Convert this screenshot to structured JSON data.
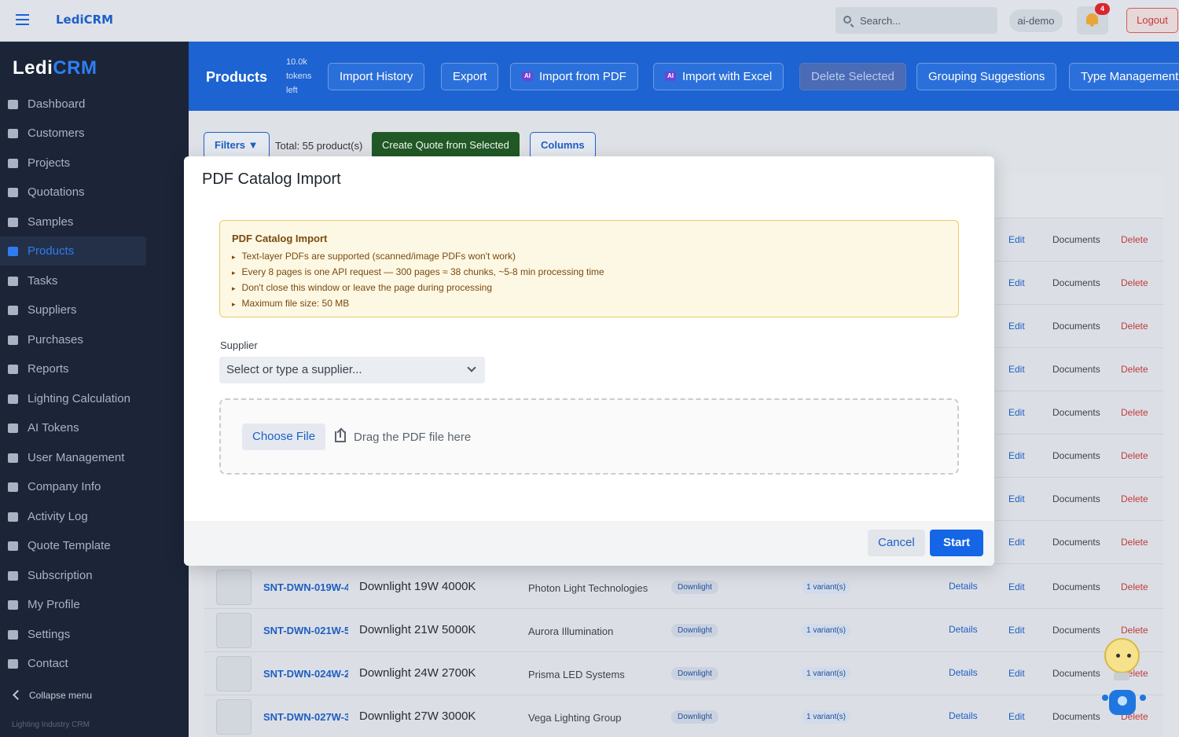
{
  "app": {
    "brand": "LediCRM",
    "logo_part1": "Ledi",
    "logo_part2": "CRM",
    "footer_note": "Lighting Industry CRM"
  },
  "topbar": {
    "search_placeholder": "Search...",
    "user": "ai-demo",
    "notification_count": "4",
    "logout_label": "Logout"
  },
  "sidebar": {
    "items": [
      {
        "label": "Dashboard",
        "icon": "dashboard-icon"
      },
      {
        "label": "Customers",
        "icon": "users-icon"
      },
      {
        "label": "Projects",
        "icon": "folder-icon"
      },
      {
        "label": "Quotations",
        "icon": "document-icon"
      },
      {
        "label": "Samples",
        "icon": "cube-icon"
      },
      {
        "label": "Products",
        "icon": "lightbulb-icon",
        "active": true
      },
      {
        "label": "Tasks",
        "icon": "list-icon"
      },
      {
        "label": "Suppliers",
        "icon": "truck-icon"
      },
      {
        "label": "Purchases",
        "icon": "cart-icon"
      },
      {
        "label": "Reports",
        "icon": "chart-icon"
      },
      {
        "label": "Lighting Calculation",
        "icon": "gear-icon"
      },
      {
        "label": "AI Tokens",
        "icon": "coins-icon"
      },
      {
        "label": "User Management",
        "icon": "user-icon"
      },
      {
        "label": "Company Info",
        "icon": "building-icon"
      },
      {
        "label": "Activity Log",
        "icon": "history-icon"
      },
      {
        "label": "Quote Template",
        "icon": "wand-icon"
      },
      {
        "label": "Subscription",
        "icon": "card-icon"
      },
      {
        "label": "My Profile",
        "icon": "profile-icon"
      },
      {
        "label": "Settings",
        "icon": "settings-icon"
      },
      {
        "label": "Contact",
        "icon": "mail-icon"
      }
    ],
    "collapse_label": "Collapse menu"
  },
  "products_header": {
    "title": "Products",
    "tokens": "10.0k tokens left",
    "buttons": {
      "import_history": "Import History",
      "export": "Export",
      "ai_tag": "AI",
      "import_pdf": "Import from PDF",
      "import_excel": "Import with Excel",
      "delete_selected": "Delete Selected",
      "grouping": "Grouping Suggestions",
      "type_management": "Type Management"
    }
  },
  "toolbar": {
    "filters": "Filters ▼",
    "total": "Total: 55 product(s)",
    "create_quote": "Create Quote from Selected",
    "columns": "Columns"
  },
  "table": {
    "action_labels": {
      "details": "Details",
      "edit": "Edit",
      "documents": "Documents",
      "delete": "Delete"
    },
    "rows": [
      {
        "code": "SNT-DWN-019W-4",
        "name": "Downlight 19W 4000K",
        "supplier": "Photon Light Technologies",
        "category": "Downlight",
        "variants": "1 variant(s)"
      },
      {
        "code": "SNT-DWN-021W-5",
        "name": "Downlight 21W 5000K",
        "supplier": "Aurora Illumination",
        "category": "Downlight",
        "variants": "1 variant(s)"
      },
      {
        "code": "SNT-DWN-024W-2",
        "name": "Downlight 24W 2700K",
        "supplier": "Prisma LED Systems",
        "category": "Downlight",
        "variants": "1 variant(s)"
      },
      {
        "code": "SNT-DWN-027W-3",
        "name": "Downlight 27W 3000K",
        "supplier": "Vega Lighting Group",
        "category": "Downlight",
        "variants": "1 variant(s)"
      }
    ]
  },
  "modal": {
    "title": "PDF Catalog Import",
    "alert_title": "PDF Catalog Import",
    "alert_items": [
      "Text-layer PDFs are supported (scanned/image PDFs won't work)",
      "Every 8 pages is one API request — 300 pages ≈ 38 chunks, ~5-8 min processing time",
      "Don't close this window or leave the page during processing",
      "Maximum file size: 50 MB"
    ],
    "supplier_label": "Supplier",
    "supplier_placeholder": "Select or type a supplier...",
    "choose_file": "Choose File",
    "drag_text": "Drag the PDF file here",
    "cancel": "Cancel",
    "start": "Start"
  }
}
